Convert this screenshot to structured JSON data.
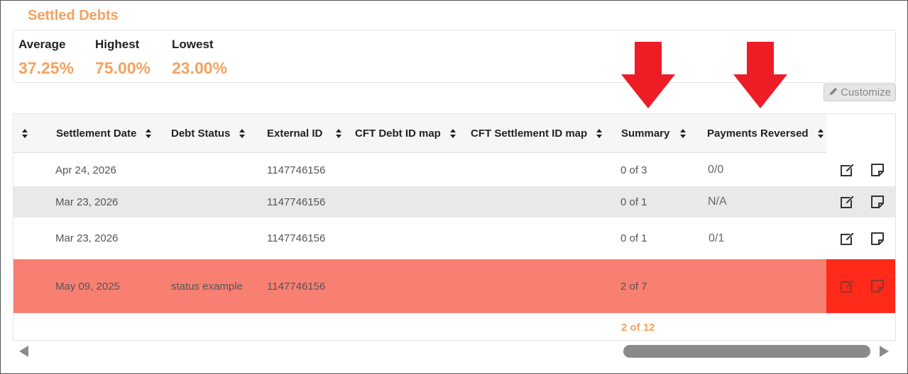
{
  "section": {
    "title": "Settled Debts"
  },
  "stats": [
    {
      "label": "Average",
      "value": "37.25%"
    },
    {
      "label": "Highest",
      "value": "75.00%"
    },
    {
      "label": "Lowest",
      "value": "23.00%"
    }
  ],
  "customize": {
    "label": "Customize",
    "icon": "pencil-icon"
  },
  "table": {
    "headers": [
      "",
      "Settlement Date",
      "Debt Status",
      "External ID",
      "CFT Debt ID map",
      "CFT Settlement ID map",
      "Summary",
      "Payments Reversed"
    ],
    "rows": [
      {
        "date": "Apr 24, 2026",
        "status": "",
        "external_id": "1147746156",
        "summary": "0 of 3",
        "payments_reversed": "0/0"
      },
      {
        "date": "Mar 23, 2026",
        "status": "",
        "external_id": "1147746156",
        "summary": "0 of 1",
        "payments_reversed": "N/A"
      },
      {
        "date": "Mar 23, 2026",
        "status": "",
        "external_id": "1147746156",
        "summary": "0 of 1",
        "payments_reversed": "0/1"
      },
      {
        "date": "May 09, 2025",
        "status": "status example",
        "external_id": "1147746156",
        "summary": "2 of 7",
        "payments_reversed": ""
      }
    ],
    "summary_footer": "2 of 12",
    "row_icons": [
      "edit-icon",
      "note-icon"
    ]
  },
  "colors": {
    "accent": "#f4a261",
    "highlight_row": "#f88072",
    "highlight_actions": "#ff2a1a",
    "annotation_arrow": "#ee1c25"
  }
}
